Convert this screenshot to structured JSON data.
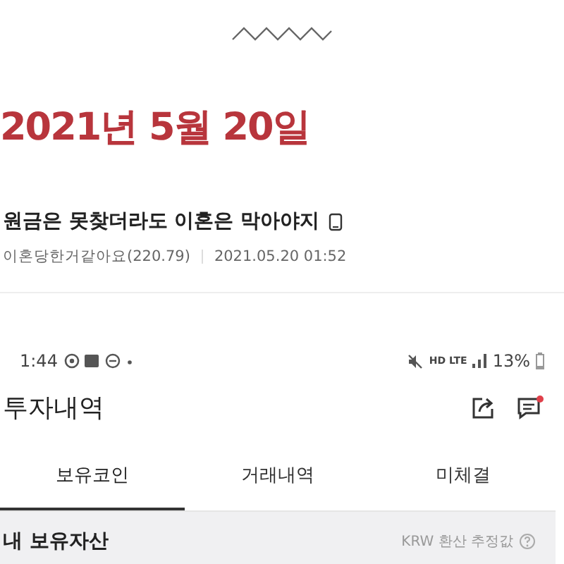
{
  "post": {
    "date": "2021년 5월 20일",
    "title": "원금은 못찾더라도 이혼은 막아야지",
    "author": "이혼당한거같아요(220.79)",
    "time": "2021.05.20 01:52"
  },
  "phone": {
    "status_bar": {
      "time": "1:44",
      "network": "HD LTE",
      "battery": "13%"
    },
    "header": {
      "title": "투자내역",
      "has_notification": true
    },
    "tabs": [
      {
        "label": "보유코인",
        "selected": true
      },
      {
        "label": "거래내역",
        "selected": false
      },
      {
        "label": "미체결",
        "selected": false
      }
    ],
    "section": {
      "title": "내 보유자산",
      "note": "KRW 환산 추정값"
    }
  }
}
